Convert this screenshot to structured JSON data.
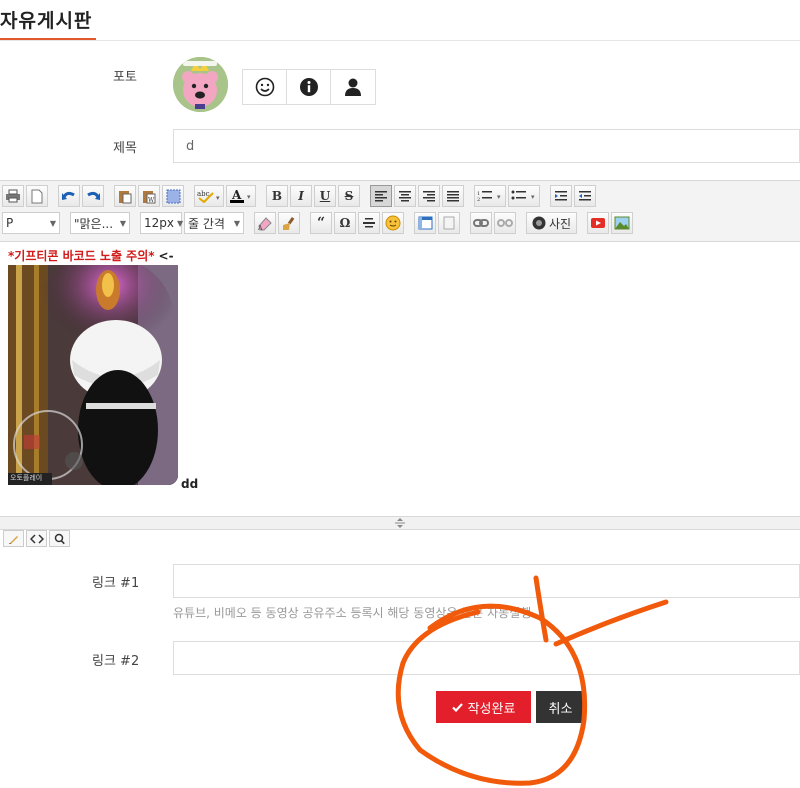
{
  "board": {
    "title": "자유게시판"
  },
  "form": {
    "photo_label": "포토",
    "subject_label": "제목",
    "subject_value": "d",
    "link1_label": "링크 #1",
    "link1_value": "",
    "link1_help": "유튜브, 비메오 등 동영상 공유주소 등록시 해당 동영상은 본문 자동실행",
    "link2_label": "링크 #2",
    "link2_value": ""
  },
  "profile_icons": [
    "smile-icon",
    "info-icon",
    "user-icon"
  ],
  "toolbar": {
    "format_select": "P",
    "font_select": "\"맑은...",
    "size_select": "12px",
    "line_height_select": "줄 간격",
    "photo_button": "사진",
    "bold": "B",
    "italic": "I",
    "underline": "U",
    "strike": "S",
    "quote": "“",
    "omega": "Ω"
  },
  "editor": {
    "notice": "*기프티콘 바코드 노출 주의*",
    "notice_tail": "<-",
    "image_badge": "오토플레이",
    "caption": "dd"
  },
  "actions": {
    "submit_label": "작성완료",
    "cancel_label": "취소"
  },
  "colors": {
    "accent": "#e2572b",
    "submit": "#e21f2a",
    "cancel": "#333333",
    "notice": "#d11a1a",
    "annotation": "#f05a0a"
  }
}
